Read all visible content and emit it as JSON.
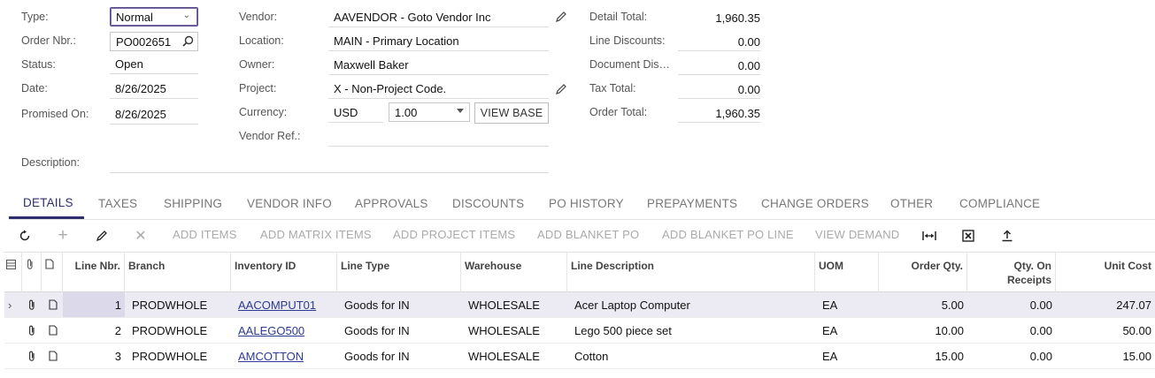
{
  "form": {
    "type": {
      "label": "Type:",
      "value": "Normal"
    },
    "order_nbr": {
      "label": "Order Nbr.:",
      "value": "PO002651"
    },
    "status": {
      "label": "Status:",
      "value": "Open"
    },
    "date": {
      "label": "Date:",
      "value": "8/26/2025"
    },
    "promised_on": {
      "label": "Promised On:",
      "value": "8/26/2025"
    },
    "description": {
      "label": "Description:",
      "value": ""
    },
    "vendor": {
      "label": "Vendor:",
      "value": "AAVENDOR - Goto Vendor Inc"
    },
    "location": {
      "label": "Location:",
      "value": "MAIN - Primary Location"
    },
    "owner": {
      "label": "Owner:",
      "value": "Maxwell Baker"
    },
    "project": {
      "label": "Project:",
      "value": "X - Non-Project Code."
    },
    "currency": {
      "label": "Currency:",
      "code": "USD",
      "rate": "1.00",
      "view_base": "VIEW BASE"
    },
    "vendor_ref": {
      "label": "Vendor Ref.:",
      "value": ""
    }
  },
  "totals": {
    "detail_total": {
      "label": "Detail Total:",
      "value": "1,960.35"
    },
    "line_discounts": {
      "label": "Line Discounts:",
      "value": "0.00"
    },
    "document_discount": {
      "label": "Document Dis…",
      "value": "0.00"
    },
    "tax_total": {
      "label": "Tax Total:",
      "value": "0.00"
    },
    "order_total": {
      "label": "Order Total:",
      "value": "1,960.35"
    }
  },
  "tabs": [
    "DETAILS",
    "TAXES",
    "SHIPPING",
    "VENDOR INFO",
    "APPROVALS",
    "DISCOUNTS",
    "PO HISTORY",
    "PREPAYMENTS",
    "CHANGE ORDERS",
    "OTHER",
    "COMPLIANCE"
  ],
  "toolbar": {
    "add_items": "ADD ITEMS",
    "add_matrix_items": "ADD MATRIX ITEMS",
    "add_project_items": "ADD PROJECT ITEMS",
    "add_blanket_po": "ADD BLANKET PO",
    "add_blanket_po_line": "ADD BLANKET PO LINE",
    "view_demand": "VIEW DEMAND"
  },
  "grid": {
    "headers": {
      "line_nbr": "Line Nbr.",
      "branch": "Branch",
      "inventory_id": "Inventory ID",
      "line_type": "Line Type",
      "warehouse": "Warehouse",
      "line_description": "Line Description",
      "uom": "UOM",
      "order_qty": "Order Qty.",
      "qty_on_receipts": "Qty. On Receipts",
      "unit_cost": "Unit Cost"
    },
    "rows": [
      {
        "line_nbr": "1",
        "branch": "PRODWHOLE",
        "inventory_id": "AACOMPUT01",
        "line_type": "Goods for IN",
        "warehouse": "WHOLESALE",
        "line_description": "Acer Laptop Computer",
        "uom": "EA",
        "order_qty": "5.00",
        "qty_on_receipts": "0.00",
        "unit_cost": "247.07"
      },
      {
        "line_nbr": "2",
        "branch": "PRODWHOLE",
        "inventory_id": "AALEGO500",
        "line_type": "Goods for IN",
        "warehouse": "WHOLESALE",
        "line_description": "Lego 500 piece set",
        "uom": "EA",
        "order_qty": "10.00",
        "qty_on_receipts": "0.00",
        "unit_cost": "50.00"
      },
      {
        "line_nbr": "3",
        "branch": "PRODWHOLE",
        "inventory_id": "AMCOTTON",
        "line_type": "Goods for IN",
        "warehouse": "WHOLESALE",
        "line_description": "Cotton",
        "uom": "EA",
        "order_qty": "15.00",
        "qty_on_receipts": "0.00",
        "unit_cost": "15.00"
      }
    ]
  }
}
